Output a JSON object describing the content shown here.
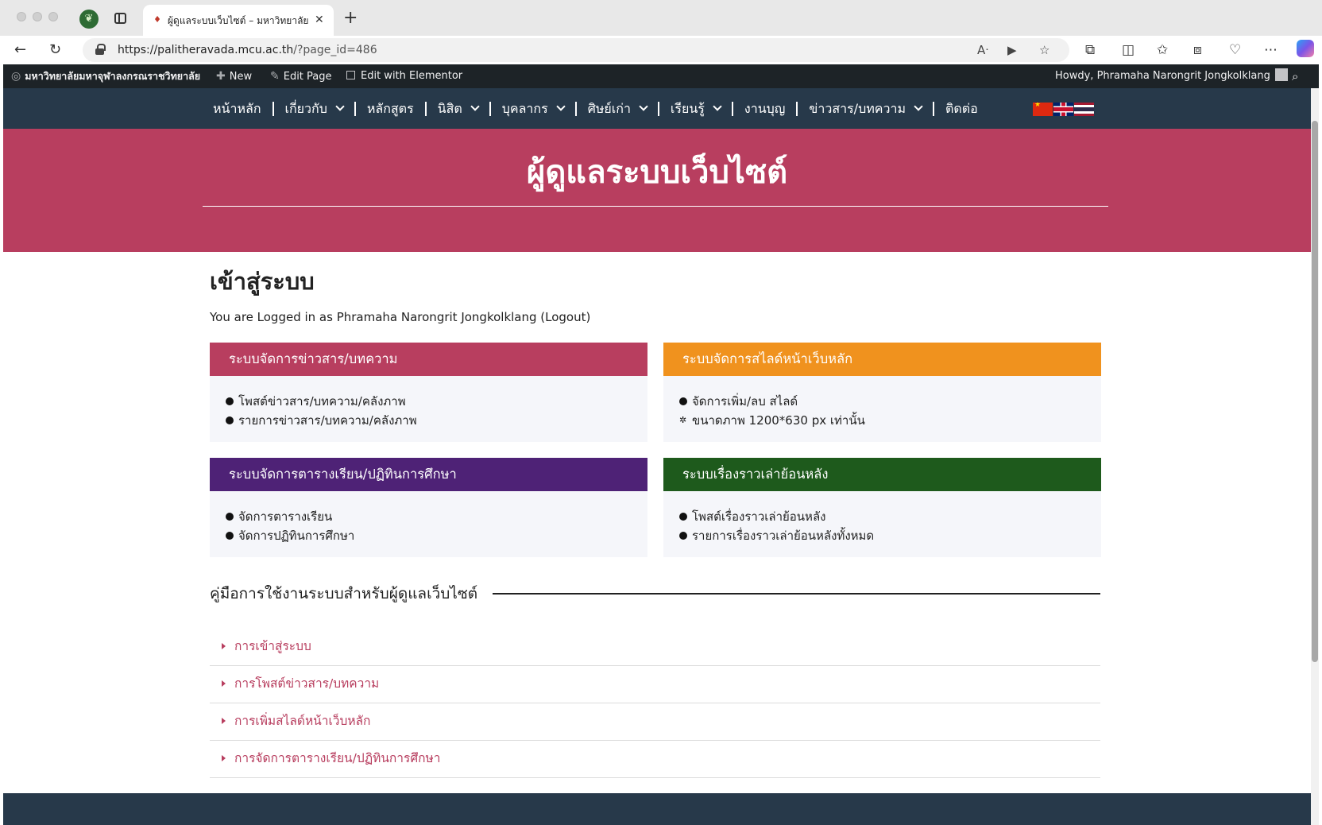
{
  "browser": {
    "tab_title": "ผู้ดูแลระบบเว็บไซต์ – มหาวิทยาลัยมหาจุฬาลงกรณราชวิทยาลัย",
    "url_domain": "https://palitheravada.mcu.ac.th",
    "url_path": "/?page_id=486"
  },
  "adminbar": {
    "site_name": "มหาวิทยาลัยมหาจุฬาลงกรณราชวิทยาลัย",
    "new_label": "New",
    "edit_page_label": "Edit Page",
    "elementor_label": "Edit with Elementor",
    "howdy_label": "Howdy, Phramaha Narongrit Jongkolklang"
  },
  "nav": {
    "items": [
      {
        "label": "หน้าหลัก",
        "dropdown": false
      },
      {
        "label": "เกี่ยวกับ",
        "dropdown": true
      },
      {
        "label": "หลักสูตร",
        "dropdown": false
      },
      {
        "label": "นิสิต",
        "dropdown": true
      },
      {
        "label": "บุคลากร",
        "dropdown": true
      },
      {
        "label": "ศิษย์เก่า",
        "dropdown": true
      },
      {
        "label": "เรียนรู้",
        "dropdown": true
      },
      {
        "label": "งานบุญ",
        "dropdown": false
      },
      {
        "label": "ข่าวสาร/บทความ",
        "dropdown": true
      },
      {
        "label": "ติดต่อ",
        "dropdown": false
      }
    ]
  },
  "hero": {
    "title": "ผู้ดูแลระบบเว็บไซต์"
  },
  "login": {
    "title": "เข้าสู่ระบบ",
    "status": "You are Logged in as Phramaha Narongrit Jongkolklang (Logout)"
  },
  "cards": [
    {
      "title": "ระบบจัดการข่าวสาร/บทความ",
      "color": "#b83e5f",
      "items": [
        "โพสต์ข่าวสาร/บทความ/คลังภาพ",
        "รายการข่าวสาร/บทความ/คลังภาพ"
      ]
    },
    {
      "title": "ระบบจัดการสไลด์หน้าเว็บหลัก",
      "color": "#f0921e",
      "items": [
        "จัดการเพิ่ม/ลบ สไลด์",
        "ขนาดภาพ 1200*630 px เท่านั้น"
      ]
    },
    {
      "title": "ระบบจัดการตารางเรียน/ปฏิทินการศึกษา",
      "color": "#4e2276",
      "items": [
        "จัดการตารางเรียน",
        "จัดการปฏิทินการศึกษา"
      ]
    },
    {
      "title": "ระบบเรื่องราวเล่าย้อนหลัง",
      "color": "#1e5a1c",
      "items": [
        "โพสต์เรื่องราวเล่าย้อนหลัง",
        "รายการเรื่องราวเล่าย้อนหลังทั้งหมด"
      ]
    }
  ],
  "manual": {
    "heading": "คู่มือการใช้งานระบบสำหรับผู้ดูแลเว็บไซต์",
    "items": [
      "การเข้าสู่ระบบ",
      "การโพสต์ข่าวสาร/บทความ",
      "การเพิ่มสไลด์หน้าเว็บหลัก",
      "การจัดการตารางเรียน/ปฏิทินการศึกษา"
    ]
  },
  "icons": {
    "flags": [
      "china-flag-icon",
      "uk-flag-icon",
      "thailand-flag-icon"
    ]
  },
  "colors": {
    "nav_bg": "#27394a",
    "hero_bg": "#b83e5f",
    "link": "#b83e5f"
  }
}
